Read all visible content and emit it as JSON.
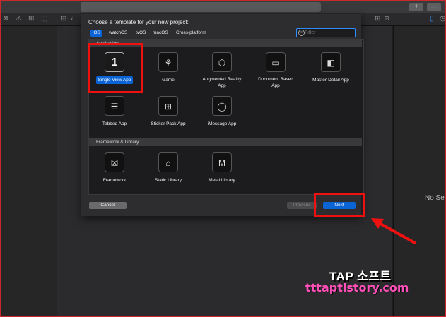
{
  "window": {
    "add_button": "+",
    "more_button": "…"
  },
  "sheet": {
    "title": "Choose a template for your new project:",
    "tabs": [
      {
        "label": "iOS",
        "active": true
      },
      {
        "label": "watchOS",
        "active": false
      },
      {
        "label": "tvOS",
        "active": false
      },
      {
        "label": "macOS",
        "active": false
      },
      {
        "label": "Cross-platform",
        "active": false
      }
    ],
    "filter_placeholder": "Filter",
    "sections": [
      {
        "title": "Application"
      },
      {
        "title": "Framework & Library"
      }
    ],
    "application_templates": [
      {
        "label": "Single View App",
        "icon": "single-view-app-icon",
        "glyph": "1",
        "selected": true
      },
      {
        "label": "Game",
        "icon": "game-robot-icon",
        "glyph": "⚘",
        "selected": false
      },
      {
        "label": "Augmented Reality App",
        "icon": "ar-cube-icon",
        "glyph": "⬡",
        "selected": false
      },
      {
        "label": "Document Based App",
        "icon": "folder-icon",
        "glyph": "▭",
        "selected": false
      },
      {
        "label": "Master-Detail App",
        "icon": "split-view-icon",
        "glyph": "◧",
        "selected": false
      },
      {
        "label": "Tabbed App",
        "icon": "tabbed-app-icon",
        "glyph": "☰",
        "selected": false
      },
      {
        "label": "Sticker Pack App",
        "icon": "sticker-grid-icon",
        "glyph": "⊞",
        "selected": false
      },
      {
        "label": "iMessage App",
        "icon": "speech-bubble-icon",
        "glyph": "◯",
        "selected": false
      }
    ],
    "framework_templates": [
      {
        "label": "Framework",
        "icon": "toolbox-icon",
        "glyph": "☒"
      },
      {
        "label": "Static Library",
        "icon": "library-building-icon",
        "glyph": "⌂"
      },
      {
        "label": "Metal Library",
        "icon": "metal-icon",
        "glyph": "M"
      }
    ],
    "buttons": {
      "cancel": "Cancel",
      "previous": "Previous",
      "next": "Next"
    }
  },
  "inspector": {
    "no_selection": "No Sele"
  },
  "watermark": {
    "line1": "TAP 소프트",
    "line2": "tttaptistory.com"
  },
  "colors": {
    "accent": "#0a64d6",
    "highlight": "#ef1010",
    "watermark_pink": "#ff4fb8"
  }
}
